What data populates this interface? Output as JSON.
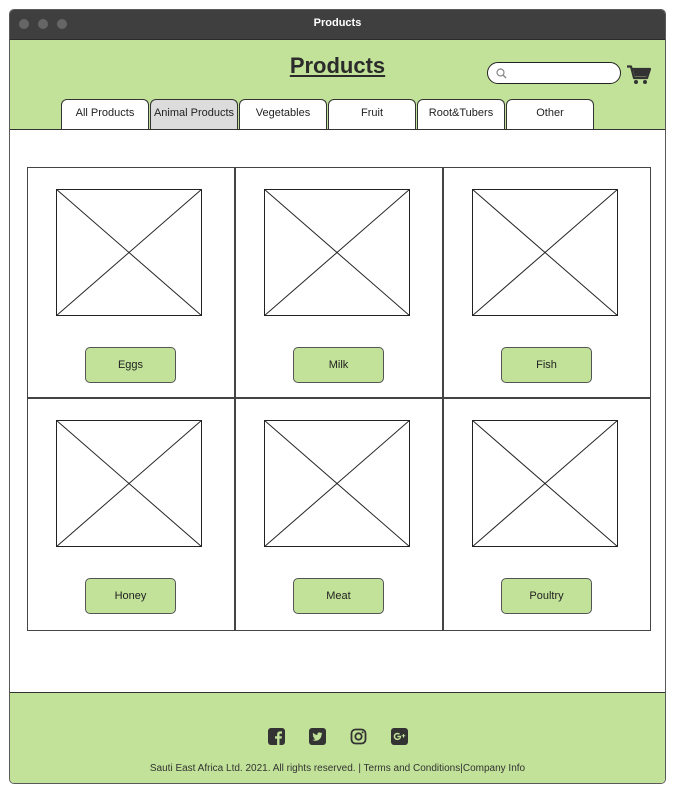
{
  "window": {
    "title": "Products"
  },
  "header": {
    "page_title": "Products",
    "search_placeholder": "",
    "search_icon": "search-icon",
    "cart_icon": "shopping-cart-icon"
  },
  "tabs": [
    {
      "label": "All Products",
      "active": false
    },
    {
      "label": "Animal Products",
      "active": true
    },
    {
      "label": "Vegetables",
      "active": false
    },
    {
      "label": "Fruit",
      "active": false
    },
    {
      "label": "Root&Tubers",
      "active": false
    },
    {
      "label": "Other",
      "active": false
    }
  ],
  "products": [
    {
      "label": "Eggs"
    },
    {
      "label": "Milk"
    },
    {
      "label": "Fish"
    },
    {
      "label": "Honey"
    },
    {
      "label": "Meat"
    },
    {
      "label": "Poultry"
    }
  ],
  "footer": {
    "social_icons": [
      "facebook-icon",
      "twitter-icon",
      "instagram-icon",
      "google-plus-icon"
    ],
    "copyright_text": "Sauti East Africa Ltd. 2021. All rights reserved. |",
    "terms_link": "Terms and Conditions",
    "separator": "|",
    "company_link": "Company Info"
  },
  "colors": {
    "header_bg": "#c1e298",
    "titlebar_bg": "#3f3f3f",
    "active_tab_bg": "#dcdcdc",
    "button_bg": "#c1e298"
  }
}
